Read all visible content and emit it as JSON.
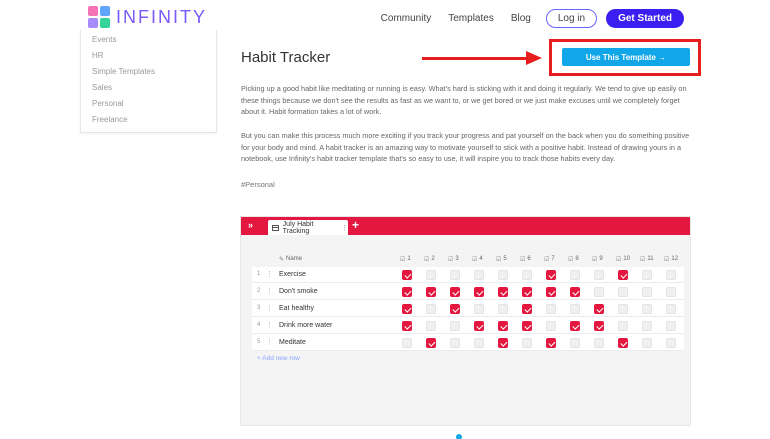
{
  "header": {
    "logo_text": "INFINITY",
    "logo_colors": [
      "#f472b6",
      "#60a5fa",
      "#a78bfa",
      "#34d399"
    ],
    "nav": [
      "Community",
      "Templates",
      "Blog"
    ],
    "login_label": "Log in",
    "get_started_label": "Get Started"
  },
  "sidebar": {
    "items": [
      "Events",
      "HR",
      "Simple Templates",
      "Sales",
      "Personal",
      "Freelance"
    ]
  },
  "main": {
    "title": "Habit Tracker",
    "use_template_label": "Use This Template →",
    "paragraphs": [
      "Picking up a good habit like meditating or running is easy. What's hard is sticking with it and doing it regularly. We tend to give up easily on these things because we don't see the results as fast as we want to, or we get bored or we just make excuses until we completely forget about it. Habit formation takes a lot of work.",
      "But you can make this process much more exciting if you track your progress and pat yourself on the back when you do something positive for your body and mind. A habit tracker is an amazing way to motivate yourself to stick with a positive habit. Instead of drawing yours in a notebook, use Infinity's habit tracker template that's so easy to use, it will inspire you to track those habits every day."
    ],
    "tag": "#Personal"
  },
  "app": {
    "chevron": "»",
    "tab_label": "July Habit Tracking",
    "add_tab": "+",
    "accent": "#e3173f",
    "name_header": "Name",
    "day_headers": [
      "1",
      "2",
      "3",
      "4",
      "5",
      "6",
      "7",
      "8",
      "9",
      "10",
      "11",
      "12"
    ],
    "rows": [
      {
        "num": "1",
        "name": "Exercise",
        "checks": [
          true,
          false,
          false,
          false,
          false,
          false,
          true,
          false,
          false,
          true,
          false,
          false
        ]
      },
      {
        "num": "2",
        "name": "Don't smoke",
        "checks": [
          true,
          true,
          true,
          true,
          true,
          true,
          true,
          true,
          false,
          false,
          false,
          false
        ]
      },
      {
        "num": "3",
        "name": "Eat healthy",
        "checks": [
          true,
          false,
          true,
          false,
          false,
          true,
          false,
          false,
          true,
          false,
          false,
          false
        ]
      },
      {
        "num": "4",
        "name": "Drink more water",
        "checks": [
          true,
          false,
          false,
          true,
          true,
          true,
          false,
          true,
          true,
          false,
          false,
          false
        ]
      },
      {
        "num": "5",
        "name": "Meditate",
        "checks": [
          false,
          true,
          false,
          false,
          true,
          false,
          true,
          false,
          false,
          true,
          false,
          false
        ]
      }
    ],
    "add_row_label": "+ Add new row"
  }
}
